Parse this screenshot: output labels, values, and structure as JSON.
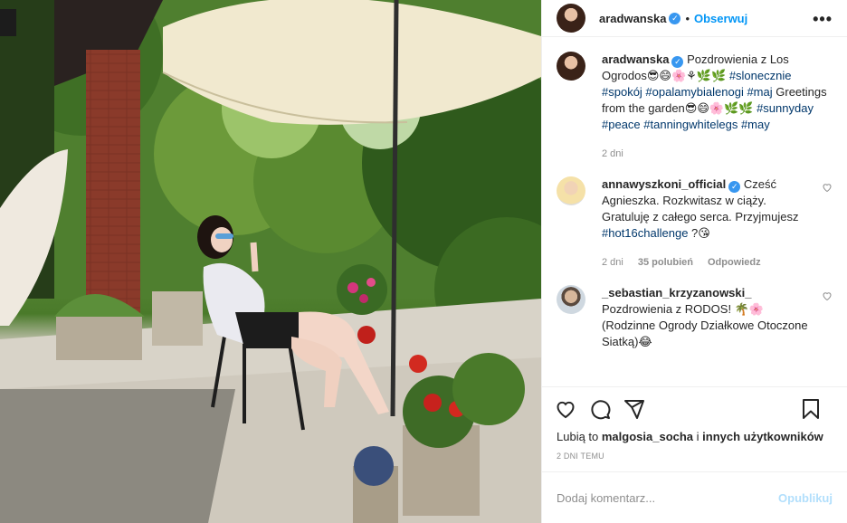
{
  "post": {
    "username": "aradwanska",
    "follow_label": "Obserwuj",
    "separator": "•",
    "verified_mark": "✓",
    "more_label": "•••"
  },
  "caption": {
    "username": "aradwanska",
    "text_1": "Pozdrowienia z Los Ogrodos😎😄🌸⚘🌿🌿",
    "tags_1": "#slonecznie #spokój #opalamybialenogi #maj",
    "text_2": "Greetings from the garden😎😄🌸🌿🌿",
    "tags_2": "#sunnyday #peace #tanningwhitelegs #may",
    "time": "2 dni"
  },
  "comments": [
    {
      "username": "annawyszkoni_official",
      "text": "Cześć Agnieszka. Rozkwitasz w ciąży. Gratuluję z całego serca. Przyjmujesz ",
      "tag": "#hot16challenge",
      "text_after": " ?😘",
      "time": "2 dni",
      "likes": "35 polubień",
      "reply": "Odpowiedz"
    },
    {
      "username": "_sebastian_krzyzanowski_",
      "text": "Pozdrowienia z RODOS! 🌴🌸 (Rodzinne Ogrody Działkowe Otoczone Siatką)😂"
    }
  ],
  "icons": [
    "heart-icon",
    "comment-icon",
    "share-icon",
    "bookmark-icon",
    "more-icon"
  ],
  "likes": {
    "prefix": "Lubią to ",
    "user": "malgosia_socha",
    "middle": " i ",
    "others": "innych użytkowników"
  },
  "date": "2 DNI TEMU",
  "add_comment": {
    "placeholder": "Dodaj komentarz...",
    "publish_label": "Opublikuj"
  },
  "colors": {
    "link": "#0095f6",
    "tag": "#00376b",
    "muted": "#8e8e8e",
    "verified": "#3897f0"
  }
}
